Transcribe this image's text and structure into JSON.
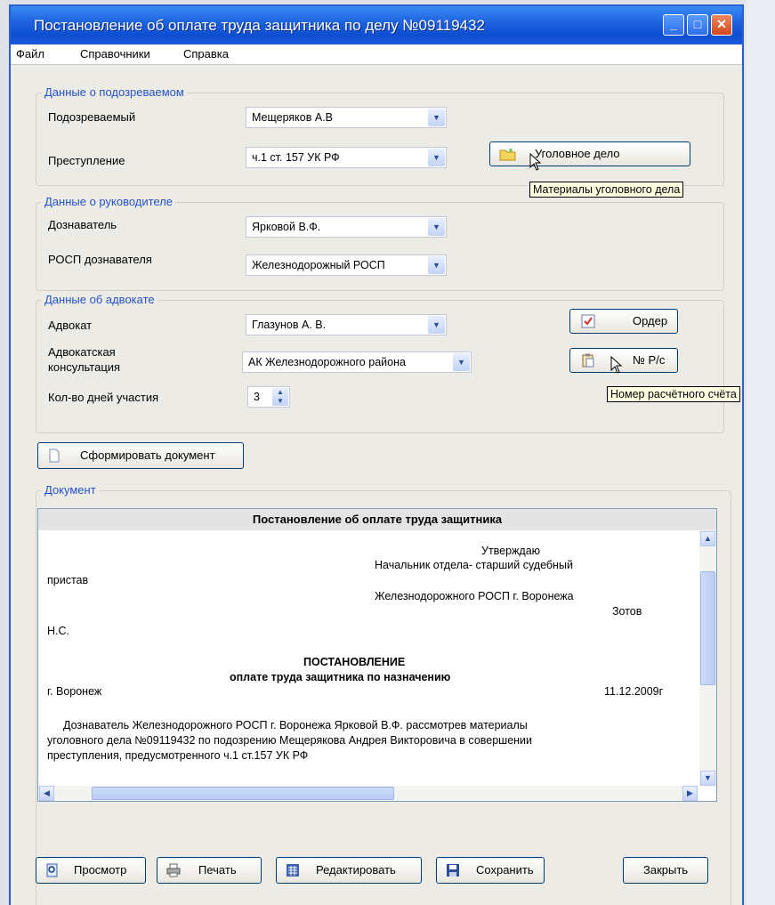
{
  "window": {
    "title": "Постановление об оплате труда защитника по делу  №09119432"
  },
  "menu": [
    "Файл",
    "Справочники",
    "Справка"
  ],
  "suspect_group": {
    "title": "Данные о подозреваемом",
    "suspect_label": "Подозреваемый",
    "suspect_value": "Мещеряков А.В",
    "crime_label": "Преступление",
    "crime_value": "ч.1 ст. 157 УК РФ",
    "case_button": "Уголовное дело",
    "case_tooltip": "Материалы уголовного дела"
  },
  "supervisor_group": {
    "title": "Данные о руководителе",
    "investigator_label": "Дознаватель",
    "investigator_value": "Ярковой В.Ф.",
    "rosp_label": "РОСП дознавателя",
    "rosp_value": "Железнодорожный РОСП"
  },
  "lawyer_group": {
    "title": "Данные об адвокате",
    "lawyer_label": "Адвокат",
    "lawyer_value": "Глазунов А. В.",
    "consult_label_1": "Адвокатская",
    "consult_label_2": "консультация",
    "consult_value": "АК Железнодорожного района",
    "days_label": "Кол-во дней участия",
    "days_value": "3",
    "order_button": "Ордер",
    "account_button": "№ Р/с",
    "account_tooltip": "Номер расчётного счёта"
  },
  "generate_button": "Сформировать документ",
  "document": {
    "group_title": "Документ",
    "header": "Постановление об оплате труда защитника",
    "approve": "Утверждаю",
    "approve_line2": "Начальник отдела- старший судебный",
    "approve_line3": "пристав",
    "approve_line4": "Железнодорожного РОСП г. Воронежа",
    "approve_line5": "Зотов",
    "approve_line6": "Н.С.",
    "heading": "ПОСТАНОВЛЕНИЕ",
    "subheading": "оплате труда защитника по назначению",
    "city": "г. Воронеж",
    "date": "11.12.2009г",
    "body_1": "Дознаватель Железнодорожного РОСП г. Воронежа Ярковой В.Ф. рассмотрев материалы",
    "body_2": "уголовного дела №09119432 по подозрению Мещерякова Андрея Викторовича в совершении",
    "body_3": "преступления, предусмотренного ч.1 ст.157 УК РФ"
  },
  "bottom_buttons": {
    "preview": "Просмотр",
    "print": "Печать",
    "edit": "Редактировать",
    "save": "Сохранить",
    "close": "Закрыть"
  }
}
